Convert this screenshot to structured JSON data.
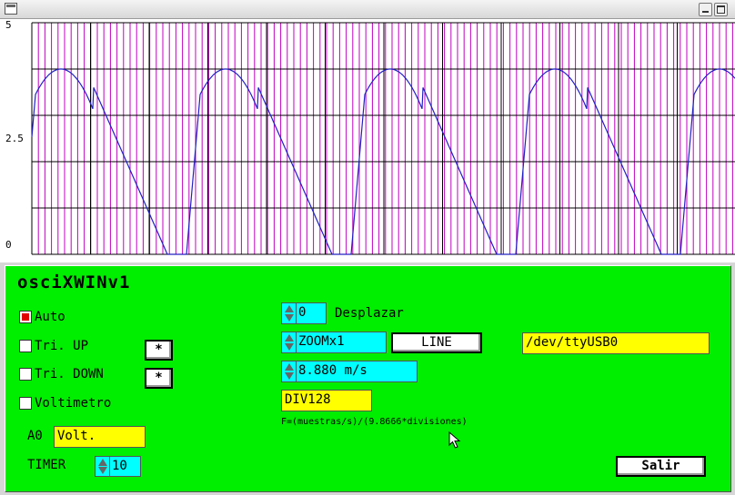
{
  "window": {
    "title": ""
  },
  "scope": {
    "y_labels": {
      "top": "5",
      "mid": "2.5",
      "bottom": "0"
    },
    "colors": {
      "minor_grid": "#c000c0",
      "major_grid": "#000000",
      "trace": "#2020c0"
    }
  },
  "panel": {
    "title": "osciXWINv1",
    "checkboxes": [
      {
        "label": "Auto",
        "checked": true
      },
      {
        "label": "Tri. UP",
        "checked": false
      },
      {
        "label": "Tri. DOWN",
        "checked": false
      },
      {
        "label": "Voltimetro",
        "checked": false
      }
    ],
    "trigger_up_btn": "*",
    "trigger_down_btn": "*",
    "channel_label": "A0",
    "channel_value": "Volt.",
    "timer_label": "TIMER",
    "timer_value": "10",
    "shift_value": "0",
    "shift_label": "Desplazar",
    "zoom_value": "ZOOMx1",
    "line_button": "LINE",
    "device_value": "/dev/ttyUSB0",
    "rate_value": "8.880 m/s",
    "div_value": "DIV128",
    "formula": "F=(muestras/s)/(9.8666*divisiones)",
    "exit_button": "Salir"
  }
}
